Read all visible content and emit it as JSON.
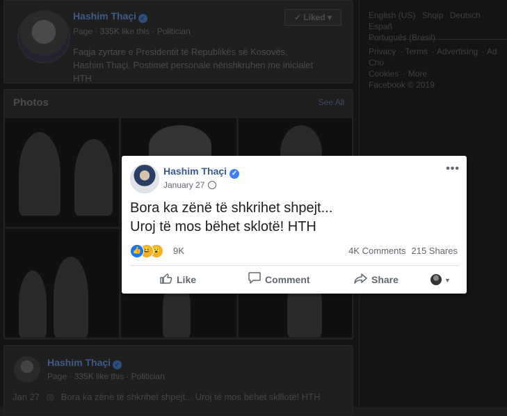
{
  "page": {
    "name": "Hashim Thaçi",
    "type_label": "Page",
    "likes": "335K like this",
    "category": "Politician",
    "liked_label": "Liked",
    "description": "Faqja zyrtare e Presidentit të Republikës së Kosovës, Hashim Thaçi. Postimet personale nënshkruhen me inicialet HTH"
  },
  "photos": {
    "title": "Photos",
    "see_all": "See All"
  },
  "right_column": {
    "languages": [
      "English (US)",
      "Shqip",
      "Deutsch",
      "Españ",
      "Português (Brasil)"
    ],
    "footer_links": [
      "Privacy",
      "Terms",
      "Advertising",
      "Ad Cho",
      "Cookies",
      "More"
    ],
    "copyright": "Facebook © 2019"
  },
  "post": {
    "author": "Hashim Thaçi",
    "date": "January 27",
    "text_line1": "Bora ka zënë të shkrihet shpejt...",
    "text_line2": "Uroj të mos bëhet sklotë! HTH",
    "reaction_count": "9K",
    "comments": "4K Comments",
    "shares": "215 Shares",
    "actions": {
      "like": "Like",
      "comment": "Comment",
      "share": "Share"
    },
    "colors": {
      "name": "#385898",
      "like_blue": "#1877f2",
      "reaction_yellow": "#f7b125"
    }
  },
  "preview": {
    "author": "Hashim Thaçi",
    "type_label": "Page",
    "likes": "335K like this",
    "category": "Politician",
    "date": "Jan 27",
    "snippet": "Bora ka zënë të shkrihet shpejt... Uroj të mos bëhet sklllotë! HTH"
  }
}
